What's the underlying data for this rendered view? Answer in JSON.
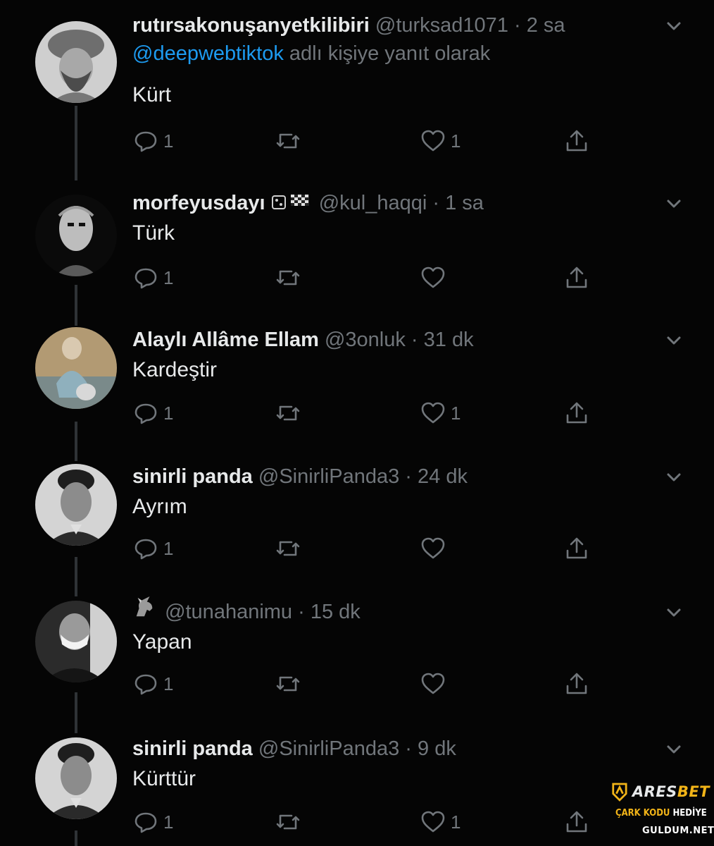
{
  "tweets": [
    {
      "name": "rutırsakonuşanyetkilibiri",
      "handle": "@turksad1071",
      "separator": "·",
      "time": "2 sa",
      "reply_mention": "@deepwebtiktok",
      "reply_suffix": "adlı kişiye yanıt olarak",
      "text": "Kürt",
      "reply_count": "1",
      "like_count": "1",
      "liked_outline": true
    },
    {
      "name": "morfeyusdayı",
      "handle": "@kul_haqqi",
      "separator": "·",
      "time": "1 sa",
      "text": "Türk",
      "reply_count": "1",
      "like_count": ""
    },
    {
      "name": "Alaylı Allâme Ellam",
      "handle": "@3onluk",
      "separator": "·",
      "time": "31 dk",
      "text": "Kardeştir",
      "reply_count": "1",
      "like_count": "1"
    },
    {
      "name": "sinirli panda",
      "handle": "@SinirliPanda3",
      "separator": "·",
      "time": "24 dk",
      "text": "Ayrım",
      "reply_count": "1",
      "like_count": ""
    },
    {
      "name": "",
      "handle": "@tunahanimu",
      "separator": "·",
      "time": "15 dk",
      "text": "Yapan",
      "reply_count": "1",
      "like_count": ""
    },
    {
      "name": "sinirli panda",
      "handle": "@SinirliPanda3",
      "separator": "·",
      "time": "9 dk",
      "text": "Kürttür",
      "reply_count": "1",
      "like_count": "1"
    }
  ],
  "icons": {
    "reply": "reply-icon",
    "retweet": "retweet-icon",
    "like": "heart-icon",
    "share": "share-icon",
    "more": "chevron-down-icon"
  },
  "colors": {
    "background": "#050505",
    "text": "#e7e9ea",
    "muted": "#71767b",
    "link": "#1d9bf0",
    "watermark_accent": "#f2b418"
  },
  "watermark": {
    "brand_main": "ARES",
    "brand_accent": "BET",
    "promo_yellow": "ÇARK KODU",
    "promo_white": "HEDİYE",
    "site": "GULDUM.NET"
  }
}
